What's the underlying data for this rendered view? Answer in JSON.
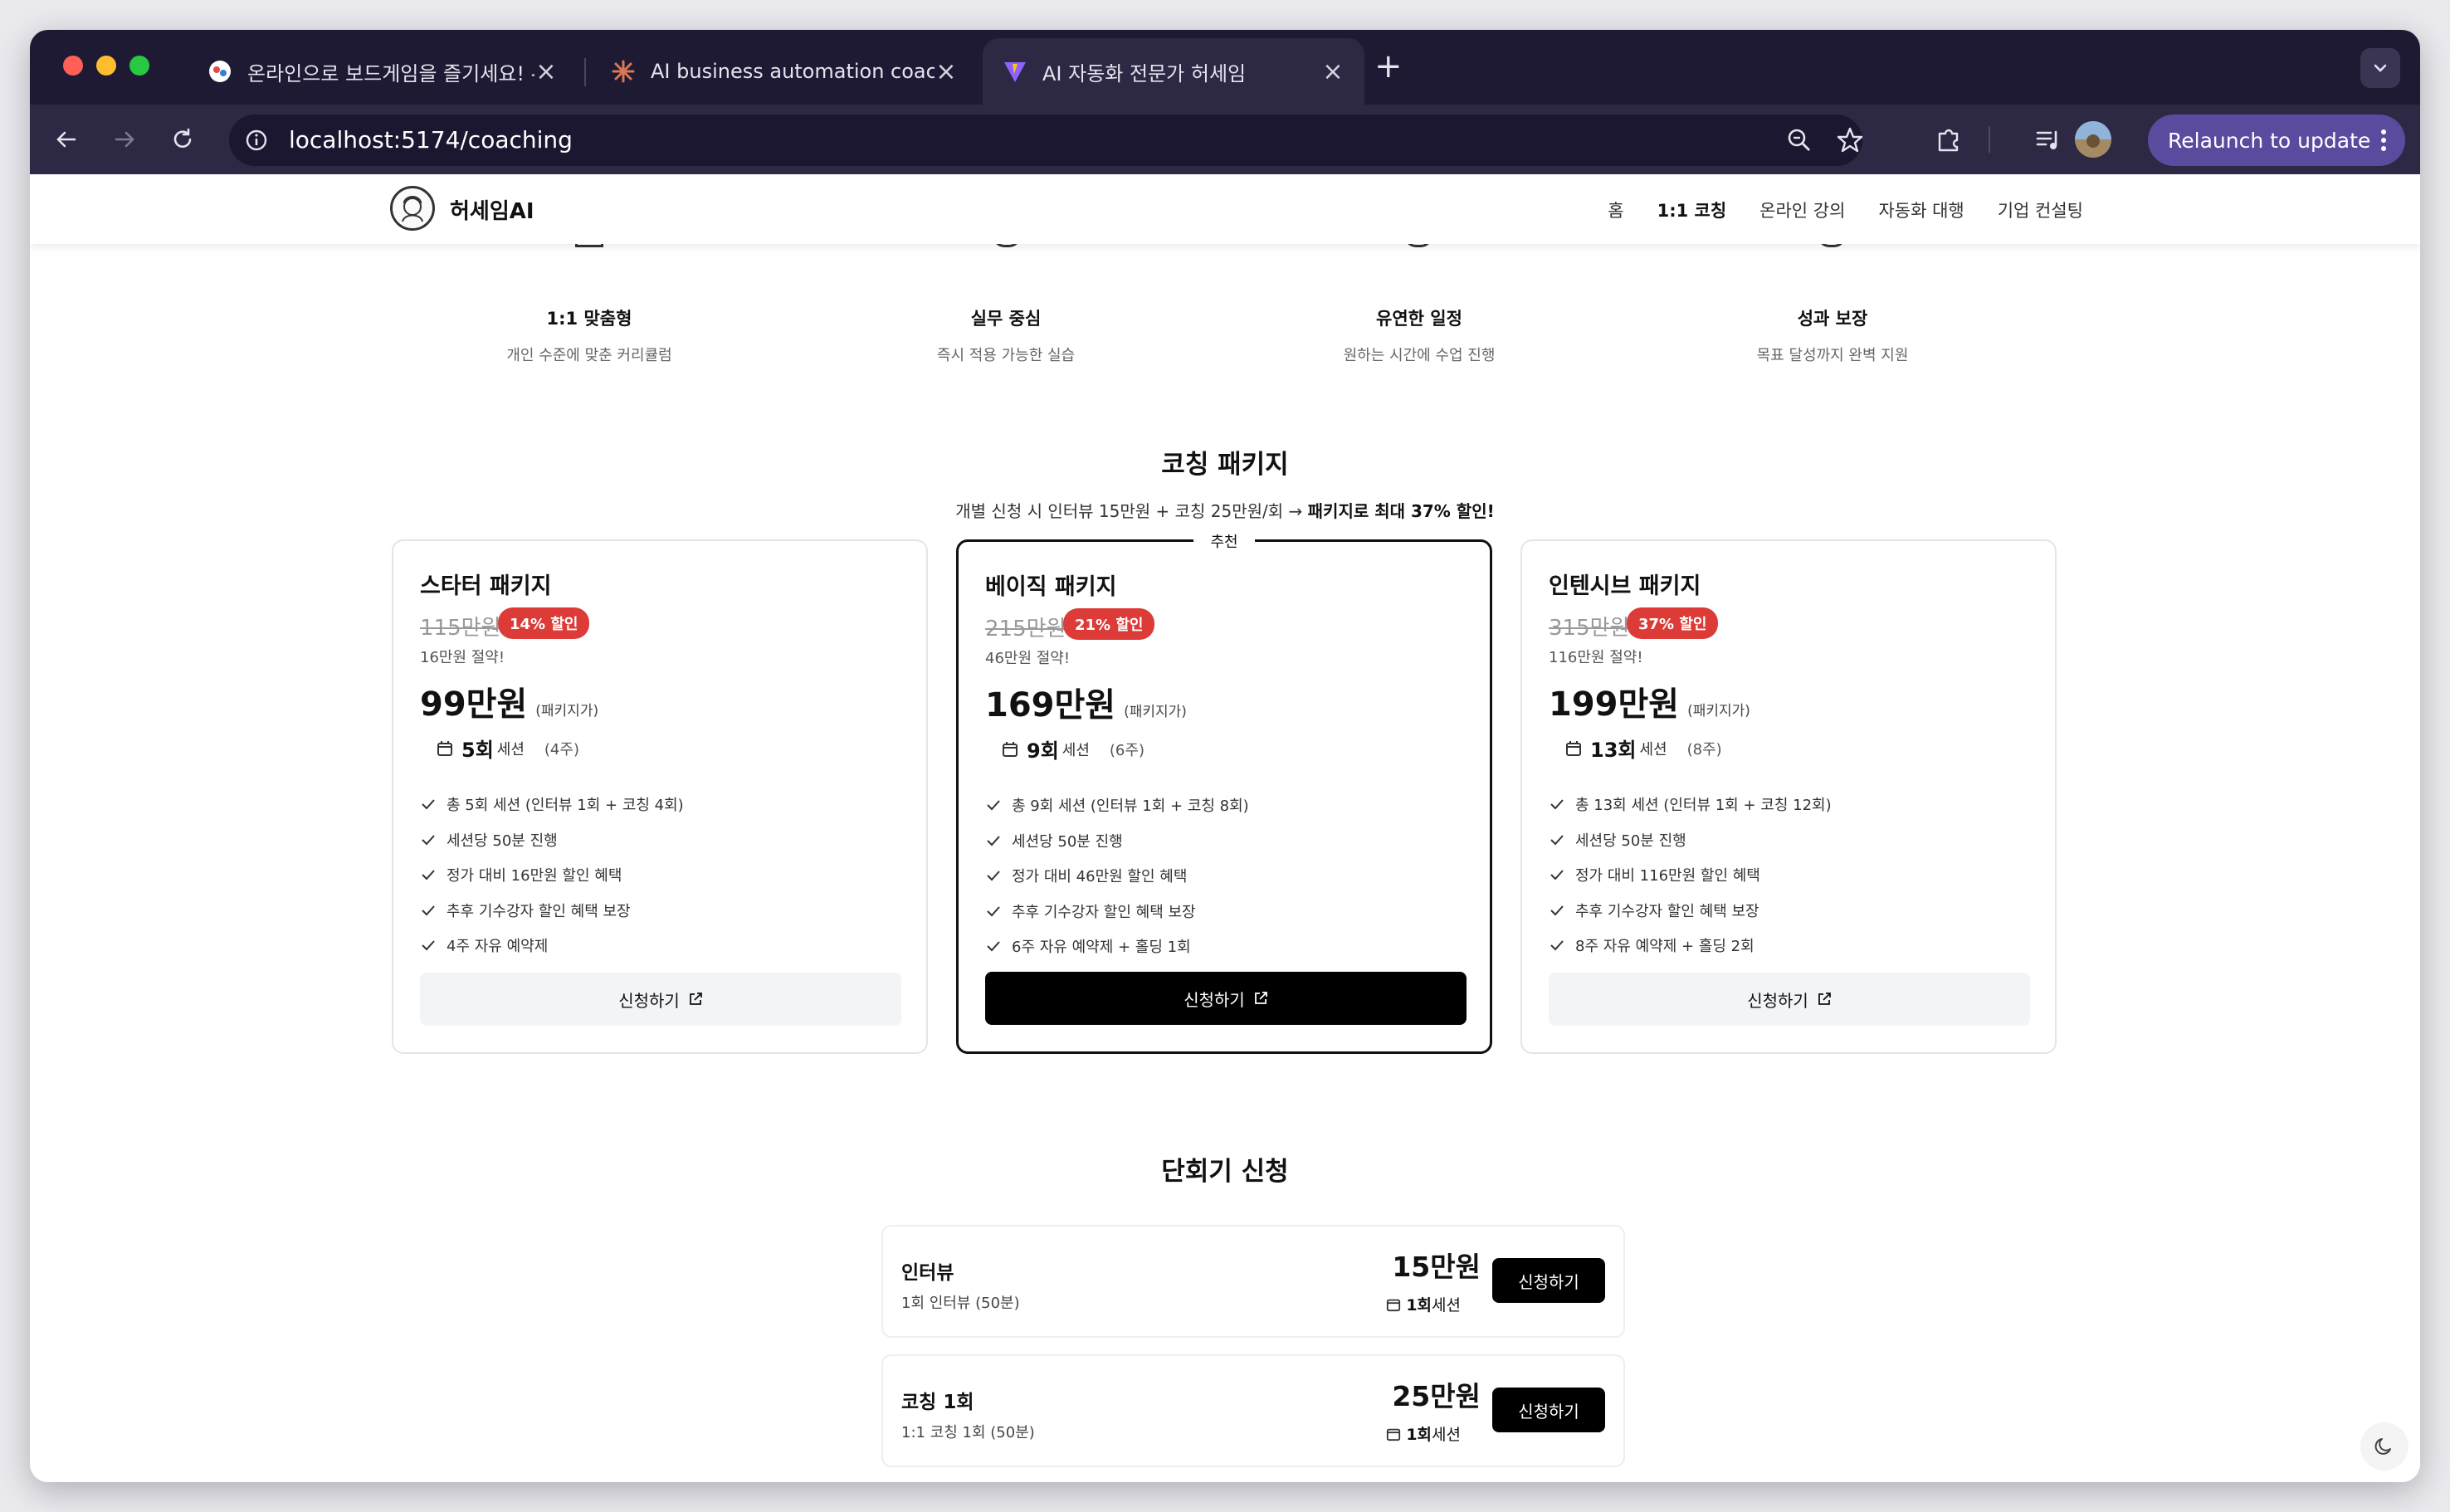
{
  "browser": {
    "tabs": [
      {
        "title": "온라인으로 보드게임을 즐기세요! -"
      },
      {
        "title": "AI business automation coach"
      },
      {
        "title": "AI 자동화 전문가 허세임"
      }
    ],
    "url": "localhost:5174/coaching",
    "relaunch_label": "Relaunch to update",
    "colors": {
      "tabstrip": "#1f1a33",
      "toolbar": "#2d2843",
      "relaunch": "#5b4b9f"
    }
  },
  "site": {
    "brand": "허세임AI",
    "nav": [
      "홈",
      "1:1 코칭",
      "온라인 강의",
      "자동화 대행",
      "기업 컨설팅"
    ],
    "active_nav": "1:1 코칭"
  },
  "features": [
    {
      "title": "1:1 맞춤형",
      "desc": "개인 수준에 맞춘 커리큘럼"
    },
    {
      "title": "실무 중심",
      "desc": "즉시 적용 가능한 실습"
    },
    {
      "title": "유연한 일정",
      "desc": "원하는 시간에 수업 진행"
    },
    {
      "title": "성과 보장",
      "desc": "목표 달성까지 완벽 지원"
    }
  ],
  "packages_section": {
    "title": "코칭 패키지",
    "subtitle_prefix": "개별 신청 시 인터뷰 15만원 + 코칭 25만원/회 → ",
    "subtitle_bold": "패키지로 최대 37% 할인!",
    "recommended_label": "추천",
    "price_note": "(패키지가)",
    "session_unit": "세션",
    "apply_label": "신청하기",
    "badge_color": "#dc3b37"
  },
  "packages": [
    {
      "name": "스타터 패키지",
      "original": "115만원",
      "badge": "14% 할인",
      "saved": "16만원 절약!",
      "price": "99만원",
      "sessions": "5회",
      "weeks": "(4주)",
      "features": [
        "총 5회 세션 (인터뷰 1회 + 코칭 4회)",
        "세션당 50분 진행",
        "정가 대비 16만원 할인 혜택",
        "추후 기수강자 할인 혜택 보장",
        "4주 자유 예약제"
      ]
    },
    {
      "name": "베이직 패키지",
      "original": "215만원",
      "badge": "21% 할인",
      "saved": "46만원 절약!",
      "price": "169만원",
      "sessions": "9회",
      "weeks": "(6주)",
      "features": [
        "총 9회 세션 (인터뷰 1회 + 코칭 8회)",
        "세션당 50분 진행",
        "정가 대비 46만원 할인 혜택",
        "추후 기수강자 할인 혜택 보장",
        "6주 자유 예약제 + 홀딩 1회"
      ]
    },
    {
      "name": "인텐시브 패키지",
      "original": "315만원",
      "badge": "37% 할인",
      "saved": "116만원 절약!",
      "price": "199만원",
      "sessions": "13회",
      "weeks": "(8주)",
      "features": [
        "총 13회 세션 (인터뷰 1회 + 코칭 12회)",
        "세션당 50분 진행",
        "정가 대비 116만원 할인 혜택",
        "추후 기수강자 할인 혜택 보장",
        "8주 자유 예약제 + 홀딩 2회"
      ]
    }
  ],
  "single_section": {
    "title": "단회기 신청",
    "items": [
      {
        "name": "인터뷰",
        "desc": "1회 인터뷰 (50분)",
        "price": "15만원",
        "session_num": "1회",
        "session_unit": "세션",
        "button": "신청하기"
      },
      {
        "name": "코칭 1회",
        "desc": "1:1 코칭 1회 (50분)",
        "price": "25만원",
        "session_num": "1회",
        "session_unit": "세션",
        "button": "신청하기"
      }
    ]
  }
}
